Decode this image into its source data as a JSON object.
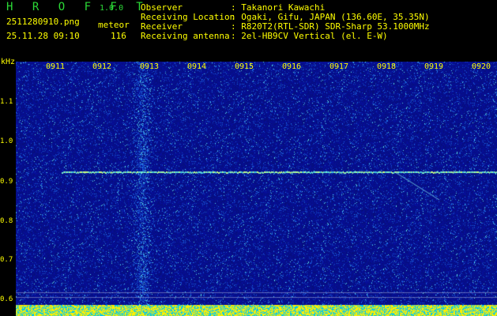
{
  "header": {
    "app_name": "H R O F F T",
    "app_version": "1.0.0",
    "file_name": "2511280910.png",
    "date_time": "25.11.28 09:10",
    "meteor_label": "meteor",
    "meteor_count": "116",
    "info": [
      {
        "label": "Observer",
        "sep": ":",
        "value": "Takanori Kawachi"
      },
      {
        "label": "Receiving Location",
        "sep": ":",
        "value": "Ogaki, Gifu, JAPAN (136.60E, 35.35N)"
      },
      {
        "label": "Receiver",
        "sep": ":",
        "value": "R820T2(RTL-SDR) SDR-Sharp 53.1000MHz"
      },
      {
        "label": "Receiving antenna",
        "sep": ":",
        "value": "2el-HB9CV Vertical (el. E-W)"
      }
    ]
  },
  "axes": {
    "y_unit": "kHz",
    "y_ticks": [
      "1.1",
      "1.0",
      "0.9",
      "0.8",
      "0.7",
      "0.6"
    ],
    "x_ticks": [
      "0911",
      "0912",
      "0913",
      "0914",
      "0915",
      "0916",
      "0917",
      "0918",
      "0919",
      "0920"
    ]
  },
  "colors": {
    "background": "#000000",
    "label": "#ffff00",
    "title": "#2bd936",
    "noise_base": "#08108c",
    "carrier": "#78f0c8",
    "ground_bar": "#ffff00",
    "ground_base": "#00e0ff"
  }
}
